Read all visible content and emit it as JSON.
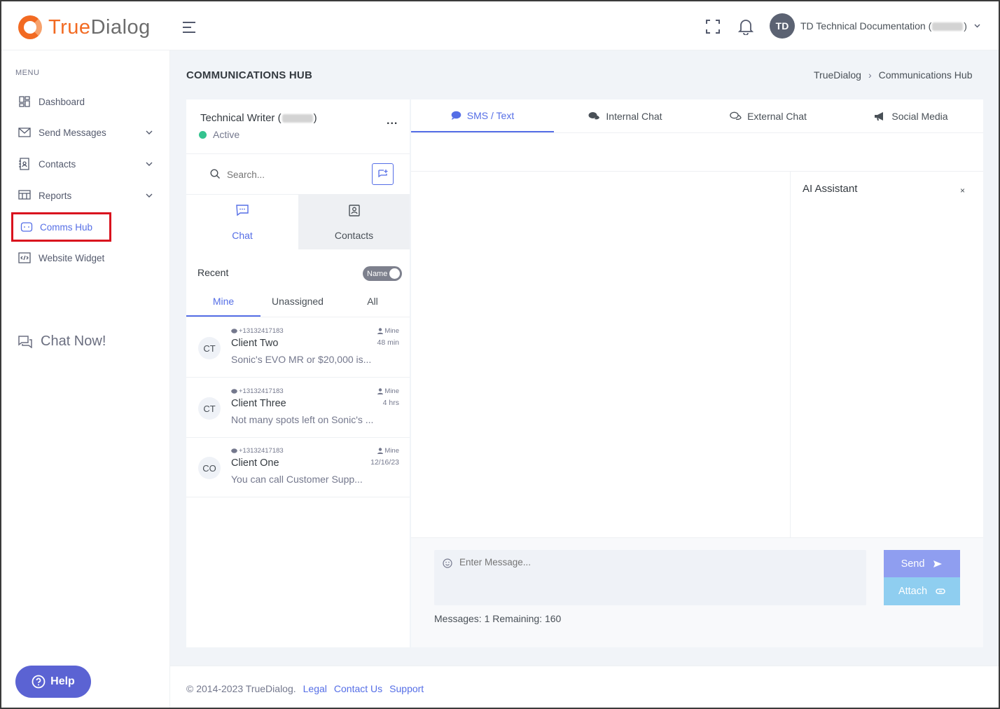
{
  "brand": {
    "part1": "True",
    "part2": "Dialog"
  },
  "header": {
    "user_initials": "TD",
    "user_name_prefix": "TD Technical Documentation (",
    "user_name_suffix": ")"
  },
  "sidebar": {
    "menu_title": "MENU",
    "items": [
      {
        "label": "Dashboard"
      },
      {
        "label": "Send Messages"
      },
      {
        "label": "Contacts"
      },
      {
        "label": "Reports"
      },
      {
        "label": "Comms Hub"
      },
      {
        "label": "Website Widget"
      }
    ],
    "chat_now": "Chat Now!",
    "help": "Help"
  },
  "page": {
    "title": "COMMUNICATIONS HUB",
    "breadcrumb": [
      "TrueDialog",
      "Communications Hub"
    ]
  },
  "left_panel": {
    "name_prefix": "Technical Writer (",
    "name_suffix": ")",
    "status": "Active",
    "more": "...",
    "search_placeholder": "Search...",
    "tabs": {
      "chat": "Chat",
      "contacts": "Contacts"
    },
    "recent_label": "Recent",
    "toggle_label": "Name",
    "subtabs": [
      "Mine",
      "Unassigned",
      "All"
    ],
    "conversations": [
      {
        "initials": "CT",
        "phone": "+13132417183",
        "name": "Client Two",
        "message": "Sonic's EVO MR or $20,000 is...",
        "owner": "Mine",
        "time": "48 min"
      },
      {
        "initials": "CT",
        "phone": "+13132417183",
        "name": "Client Three",
        "message": "Not many spots left on Sonic's ...",
        "owner": "Mine",
        "time": "4 hrs"
      },
      {
        "initials": "CO",
        "phone": "+13132417183",
        "name": "Client One",
        "message": "You can call Customer Supp...",
        "owner": "Mine",
        "time": "12/16/23"
      }
    ]
  },
  "right_panel": {
    "tabs": [
      "SMS / Text",
      "Internal Chat",
      "External Chat",
      "Social Media"
    ],
    "ai_title": "AI Assistant",
    "ai_close": "×",
    "message_placeholder": "Enter Message...",
    "send": "Send",
    "attach": "Attach",
    "message_count": "Messages: 1 Remaining: 160"
  },
  "footer": {
    "copyright": "© 2014-2023 TrueDialog.",
    "links": [
      "Legal",
      "Contact Us",
      "Support"
    ]
  },
  "colors": {
    "accent": "#556ee6",
    "brand_orange": "#f26a22",
    "active_green": "#34c38f",
    "highlight_red": "#d9121e"
  }
}
